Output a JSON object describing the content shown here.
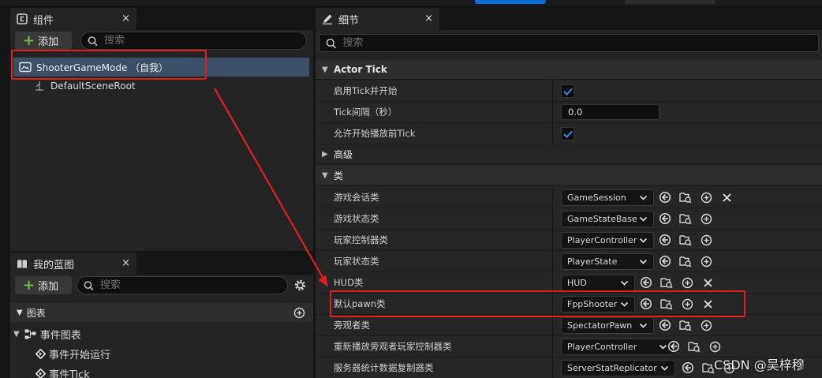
{
  "components_panel": {
    "tab_title": "组件",
    "close": "×",
    "add_label": "添加",
    "search_placeholder": "搜索",
    "items": [
      {
        "label": "ShooterGameMode （自我）"
      },
      {
        "label": "DefaultSceneRoot"
      }
    ]
  },
  "blueprint_panel": {
    "tab_title": "我的蓝图",
    "close": "×",
    "add_label": "添加",
    "search_placeholder": "搜索",
    "graph_section": "图表",
    "event_graph": "事件图表",
    "events": [
      "事件开始运行",
      "事件Tick"
    ]
  },
  "details_panel": {
    "tab_title": "细节",
    "close": "×",
    "search_placeholder": "搜索",
    "sections": {
      "actor_tick": "Actor Tick",
      "advanced": "高级",
      "classes": "类"
    },
    "actor_tick_rows": [
      {
        "label": "启用Tick并开始",
        "type": "checkbox",
        "checked": true
      },
      {
        "label": "Tick间隔（秒）",
        "type": "number",
        "value": "0.0"
      },
      {
        "label": "允许开始播放前Tick",
        "type": "checkbox",
        "checked": true
      }
    ],
    "class_rows": [
      {
        "label": "游戏会话类",
        "value": "GameSession",
        "last_icon": "clear-icon"
      },
      {
        "label": "游戏状态类",
        "value": "GameStateBase",
        "last_icon": "add-icon"
      },
      {
        "label": "玩家控制器类",
        "value": "PlayerController",
        "last_icon": "add-icon"
      },
      {
        "label": "玩家状态类",
        "value": "PlayerState",
        "last_icon": "add-icon"
      },
      {
        "label": "HUD类",
        "value": "HUD",
        "last_icon": "clear-icon"
      },
      {
        "label": "默认pawn类",
        "value": "FppShooter",
        "last_icon": "clear-icon"
      },
      {
        "label": "旁观者类",
        "value": "SpectatorPawn",
        "last_icon": "add-icon"
      },
      {
        "label": "重新播放旁观者玩家控制器类",
        "value": "PlayerController",
        "last_icon": "add-icon"
      },
      {
        "label": "服务器统计数据复制器类",
        "value": "ServerStatReplicator",
        "last_icon": "add-icon"
      }
    ]
  },
  "watermark": "CSDN @吴梓穆",
  "colors": {
    "accent_add": "#6dbf3a",
    "annotation_red": "#e02020",
    "selection": "#3b4f66",
    "checkbox_tick": "#2d8cf0"
  }
}
